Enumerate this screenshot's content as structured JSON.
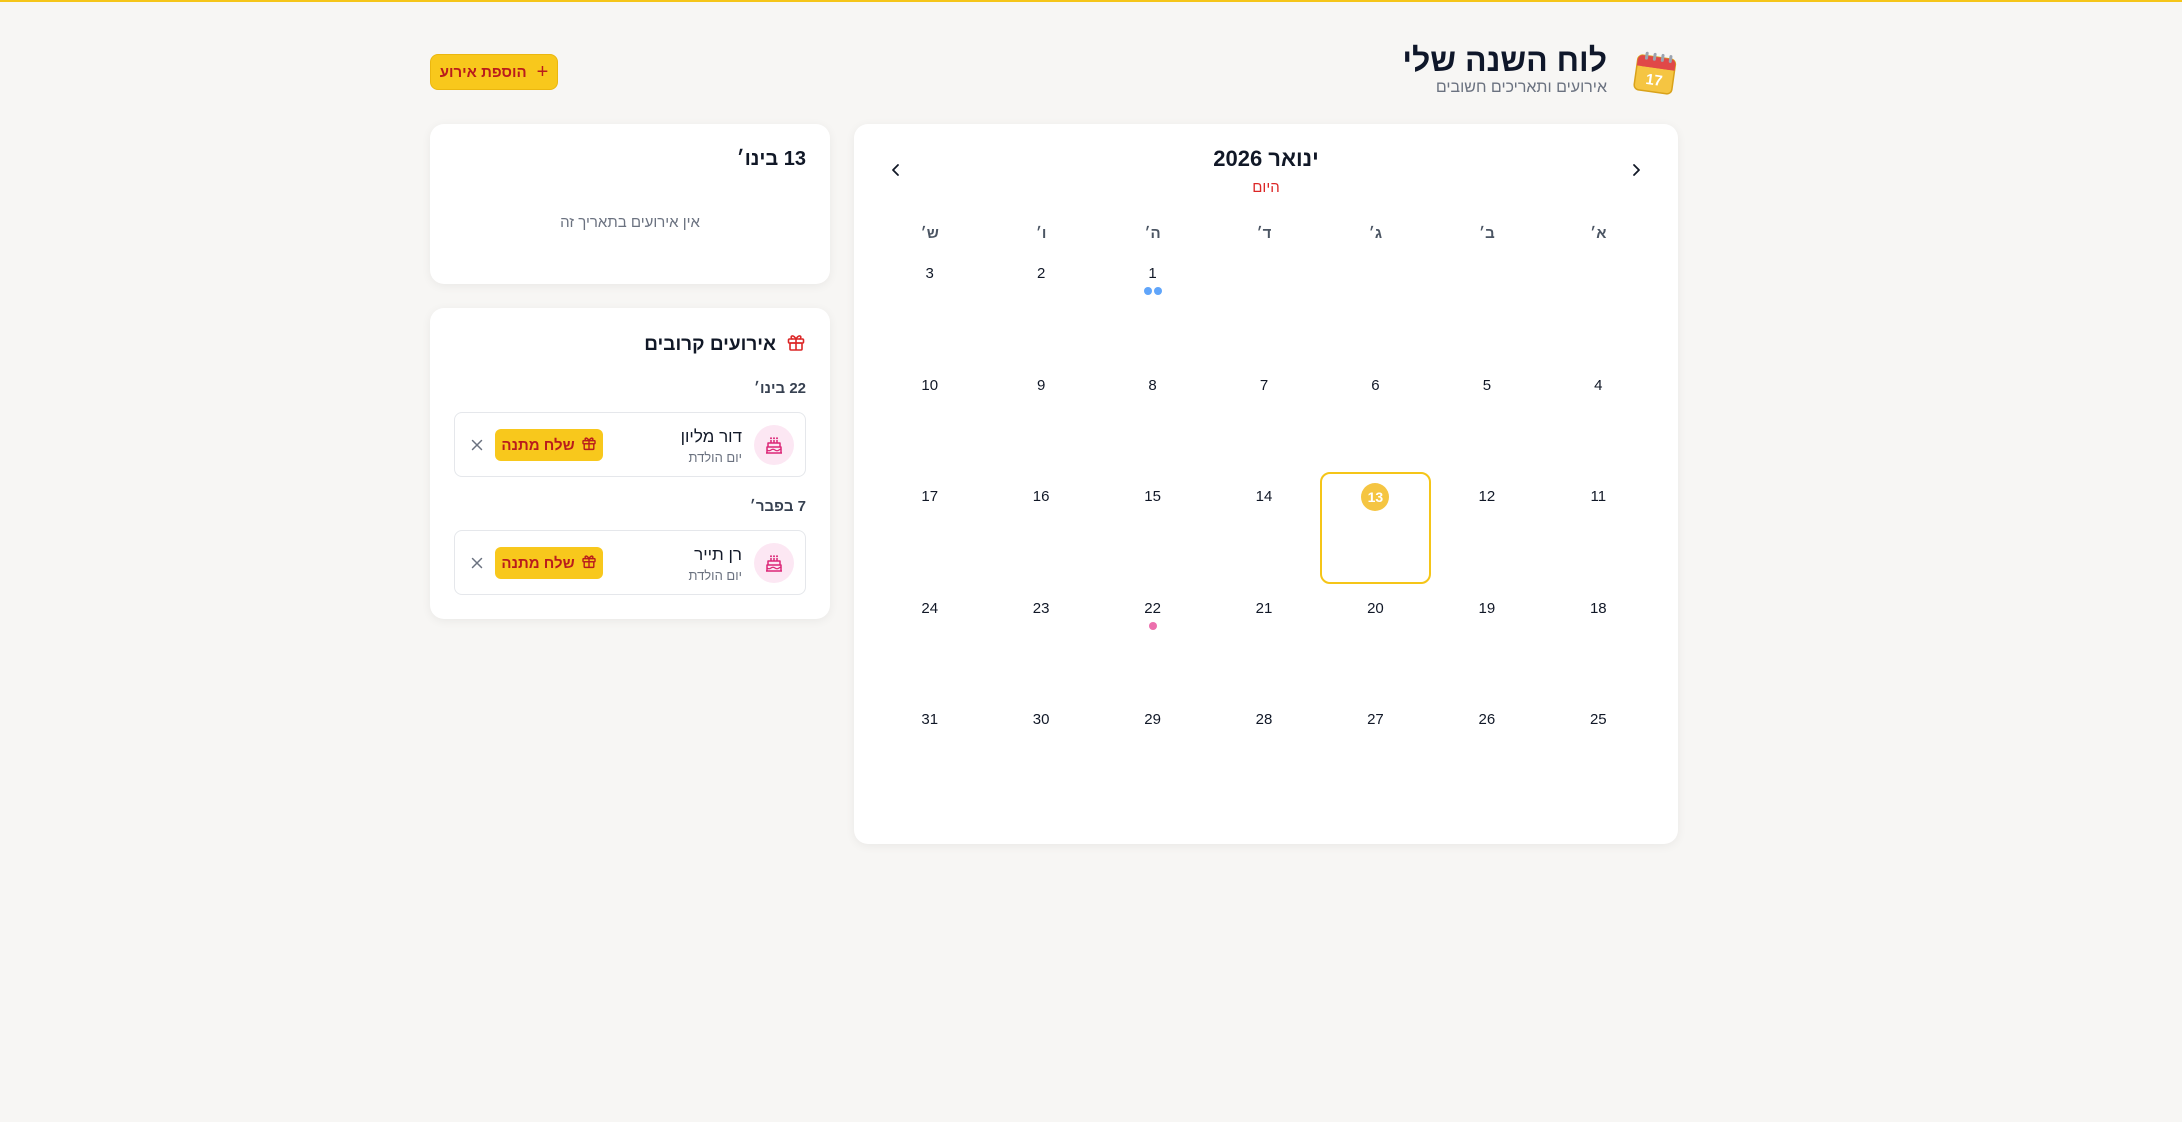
{
  "header": {
    "title": "לוח השנה שלי",
    "subtitle": "אירועים ותאריכים חשובים",
    "add_button_label": "הוספת אירוע"
  },
  "calendar": {
    "month_title": "ינואר 2026",
    "today_label": "היום",
    "weekdays": [
      "א׳",
      "ב׳",
      "ג׳",
      "ד׳",
      "ה׳",
      "ו׳",
      "ש׳"
    ],
    "today_day": 13,
    "weeks": [
      [
        null,
        null,
        null,
        null,
        {
          "day": "1",
          "dots": [
            "#60a5fa",
            "#60a5fa"
          ]
        },
        {
          "day": "2"
        },
        {
          "day": "3"
        }
      ],
      [
        {
          "day": "4"
        },
        {
          "day": "5"
        },
        {
          "day": "6"
        },
        {
          "day": "7"
        },
        {
          "day": "8"
        },
        {
          "day": "9"
        },
        {
          "day": "10"
        }
      ],
      [
        {
          "day": "11"
        },
        {
          "day": "12"
        },
        {
          "day": "13"
        },
        {
          "day": "14"
        },
        {
          "day": "15"
        },
        {
          "day": "16"
        },
        {
          "day": "17"
        }
      ],
      [
        {
          "day": "18"
        },
        {
          "day": "19"
        },
        {
          "day": "20"
        },
        {
          "day": "21"
        },
        {
          "day": "22",
          "dots": [
            "#ec6fad"
          ]
        },
        {
          "day": "23"
        },
        {
          "day": "24"
        }
      ],
      [
        {
          "day": "25"
        },
        {
          "day": "26"
        },
        {
          "day": "27"
        },
        {
          "day": "28"
        },
        {
          "day": "29"
        },
        {
          "day": "30"
        },
        {
          "day": "31"
        }
      ]
    ]
  },
  "selected_date": {
    "title": "13 בינו׳",
    "empty_text": "אין אירועים בתאריך זה"
  },
  "upcoming": {
    "title": "אירועים קרובים",
    "groups": [
      {
        "date_label": "22 בינו׳",
        "event": {
          "name": "דור מליון",
          "type": "יום הולדת",
          "gift_label": "שלח מתנה"
        }
      },
      {
        "date_label": "7 בפבר׳",
        "event": {
          "name": "רן תייר",
          "type": "יום הולדת",
          "gift_label": "שלח מתנה"
        }
      }
    ]
  },
  "colors": {
    "accent": "#f8c81c",
    "accent_text": "#b91c1c",
    "dot_blue": "#60a5fa",
    "dot_pink": "#ec6fad",
    "today_border": "#f5c518"
  },
  "icons": {
    "logo": "calendar-icon",
    "add": "plus-icon",
    "prev": "chevron-right-icon",
    "next": "chevron-left-icon",
    "upcoming": "gift-icon",
    "event_avatar": "cake-icon",
    "gift_button": "gift-icon",
    "remove": "close-icon"
  }
}
